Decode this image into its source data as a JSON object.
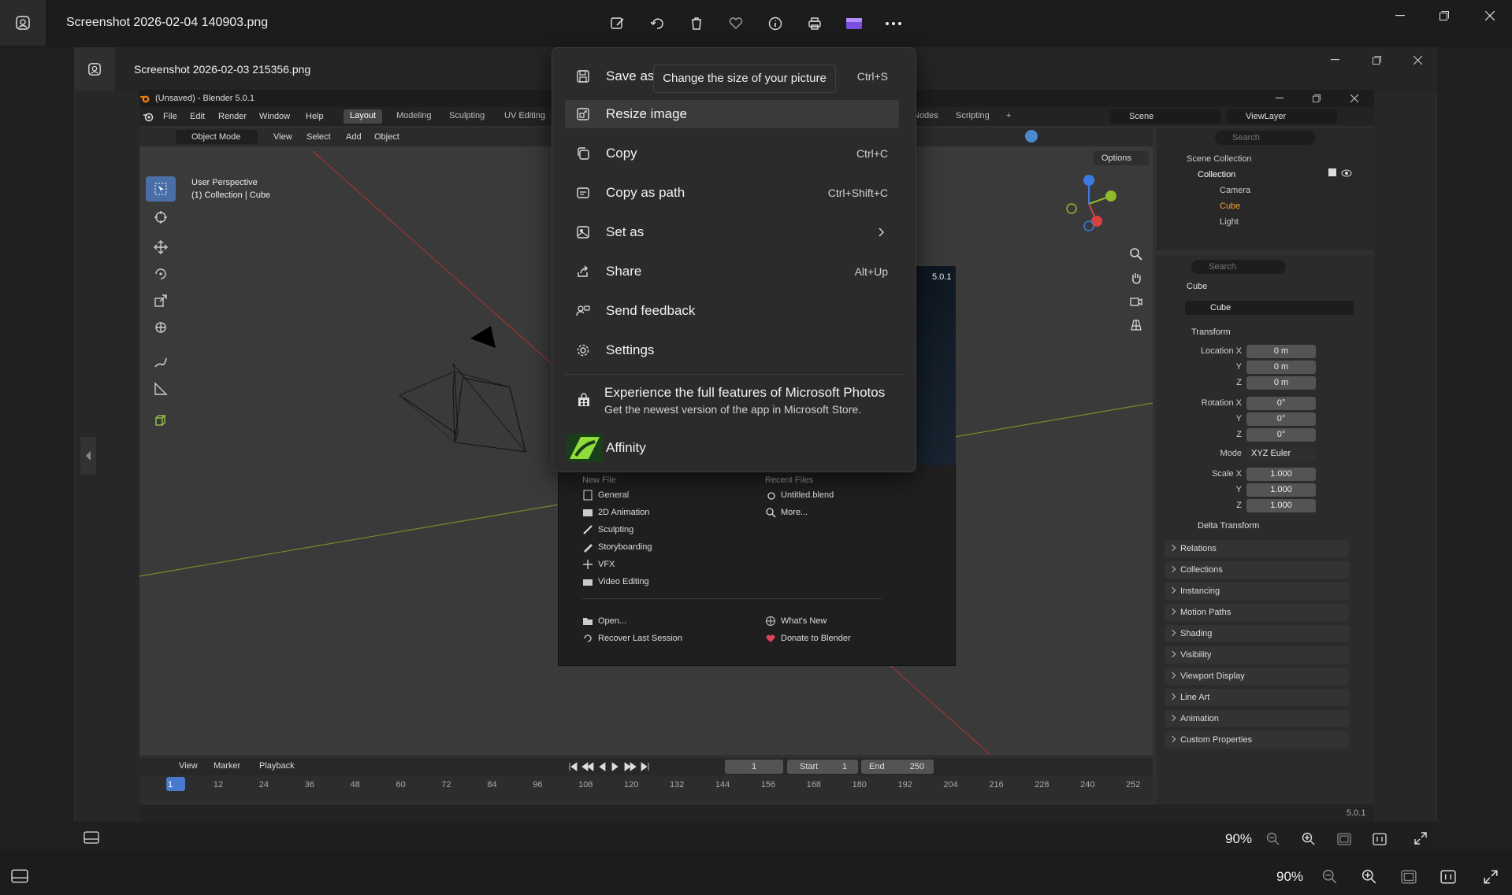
{
  "outer": {
    "filename": "Screenshot 2026-02-04 140903.png",
    "zoom": "90%"
  },
  "inner": {
    "filename": "Screenshot 2026-02-03 215356.png",
    "zoom": "90%"
  },
  "context_menu": {
    "tooltip": "Change the size of your picture",
    "items": [
      {
        "label": "Save as",
        "shortcut": "Ctrl+S"
      },
      {
        "label": "Resize image",
        "shortcut": ""
      },
      {
        "label": "Copy",
        "shortcut": "Ctrl+C"
      },
      {
        "label": "Copy as path",
        "shortcut": "Ctrl+Shift+C"
      },
      {
        "label": "Set as",
        "shortcut": ""
      },
      {
        "label": "Share",
        "shortcut": "Alt+Up"
      },
      {
        "label": "Send feedback",
        "shortcut": ""
      },
      {
        "label": "Settings",
        "shortcut": ""
      }
    ],
    "promo_title": "Experience the full features of Microsoft Photos",
    "promo_subtitle": "Get the newest version of the app in Microsoft Store.",
    "affinity_label": "Affinity"
  },
  "blender": {
    "title": "(Unsaved) - Blender 5.0.1",
    "menus": [
      "File",
      "Edit",
      "Render",
      "Window",
      "Help"
    ],
    "workspaces": [
      "Layout",
      "Modeling",
      "Sculpting",
      "UV Editing"
    ],
    "workspaces_right": [
      "Nodes",
      "Scripting",
      "+"
    ],
    "scene": "Scene",
    "view_layer": "ViewLayer",
    "vp_header": {
      "mode": "Object Mode",
      "items": [
        "View",
        "Select",
        "Add",
        "Object"
      ],
      "options": "Options"
    },
    "overlay": {
      "line1": "User Perspective",
      "line2": "(1) Collection | Cube"
    },
    "outliner": {
      "search": "Search",
      "scene_collection": "Scene Collection",
      "collection": "Collection",
      "objects": [
        "Camera",
        "Cube",
        "Light"
      ]
    },
    "props": {
      "search": "Search",
      "object_name": "Cube",
      "data_name": "Cube",
      "transform": "Transform",
      "location_label": "Location X",
      "location": [
        "0 m",
        "0 m",
        "0 m"
      ],
      "rotation_label": "Rotation X",
      "rotation": [
        "0°",
        "0°",
        "0°"
      ],
      "mode_label": "Mode",
      "mode": "XYZ Euler",
      "scale_label": "Scale X",
      "scale": [
        "1.000",
        "1.000",
        "1.000"
      ],
      "y": "Y",
      "z": "Z",
      "delta": "Delta Transform",
      "panels": [
        "Relations",
        "Collections",
        "Instancing",
        "Motion Paths",
        "Shading",
        "Visibility",
        "Viewport Display",
        "Line Art",
        "Animation",
        "Custom Properties"
      ]
    },
    "splash": {
      "version": "5.0.1",
      "new_file": "New File",
      "recent_files": "Recent Files",
      "new_items": [
        "General",
        "2D Animation",
        "Sculpting",
        "Storyboarding",
        "VFX",
        "Video Editing"
      ],
      "recent_items": [
        "Untitled.blend",
        "More..."
      ],
      "open": "Open...",
      "recover": "Recover Last Session",
      "whats_new": "What's New",
      "donate": "Donate to Blender"
    },
    "timeline": {
      "menus": [
        "View",
        "Marker",
        "Playback"
      ],
      "frame": "1",
      "start_label": "Start",
      "start": "1",
      "end_label": "End",
      "end": "250",
      "ticks": [
        "1",
        "12",
        "24",
        "36",
        "48",
        "60",
        "72",
        "84",
        "96",
        "108",
        "120",
        "132",
        "144",
        "156",
        "168",
        "180",
        "192",
        "204",
        "216",
        "228",
        "240",
        "252"
      ]
    },
    "status_version": "5.0.1"
  }
}
